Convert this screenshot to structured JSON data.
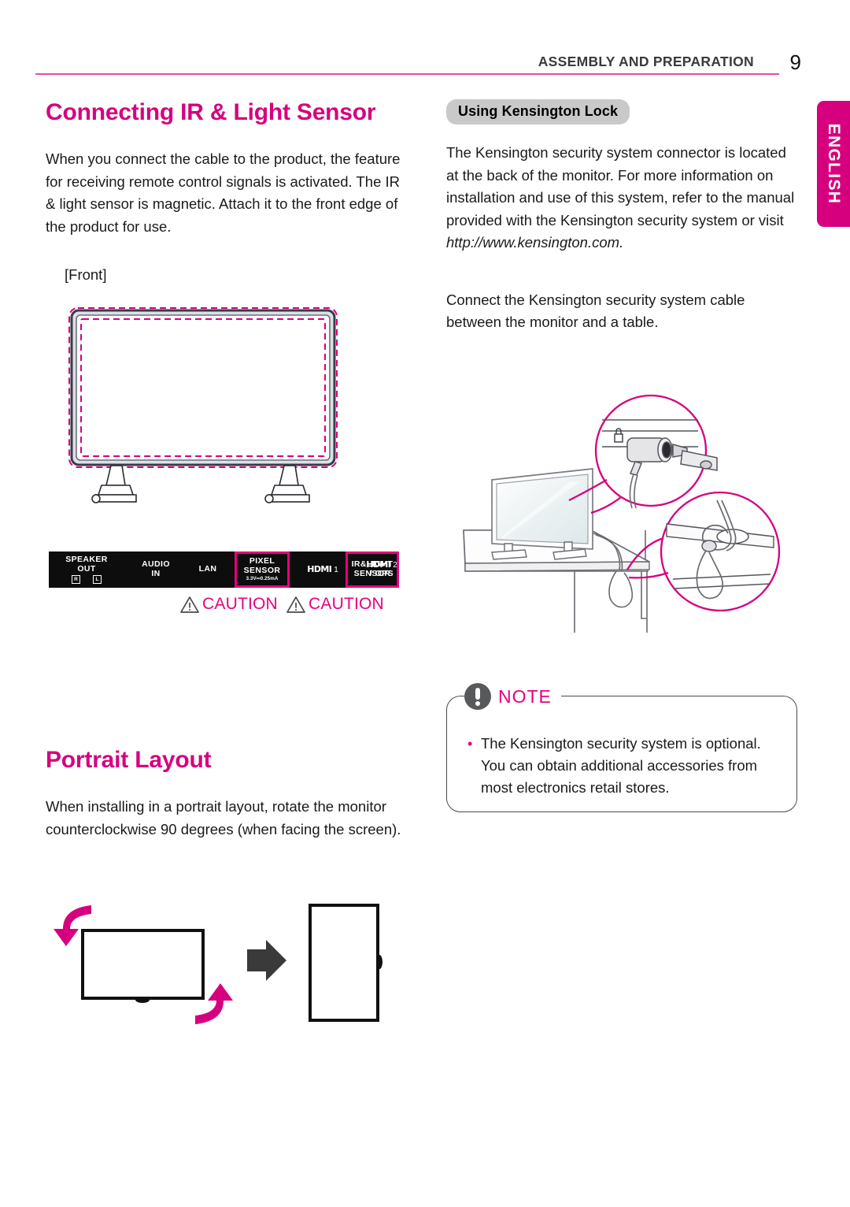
{
  "header": {
    "title": "ASSEMBLY AND PREPARATION",
    "page_number": "9",
    "rule_color": "#ee4b9b"
  },
  "language_tab": {
    "label": "ENGLISH",
    "color": "#d6007f"
  },
  "left_column": {
    "section_title": "Connecting IR & Light Sensor",
    "paragraph": "When you connect the cable to the product, the feature for receiving remote control signals is activated. The IR & light sensor is magnetic. Attach it to the front edge of the product for use.",
    "front_label": "[Front]",
    "port_strip": {
      "ports": [
        {
          "line1": "SPEAKER",
          "line2": "OUT",
          "sub": "",
          "channels": [
            "R",
            "L"
          ],
          "highlighted": false
        },
        {
          "line1": "AUDIO",
          "line2": "IN",
          "sub": "",
          "highlighted": false
        },
        {
          "line1": "LAN",
          "line2": "",
          "sub": "",
          "highlighted": false
        },
        {
          "line1": "PIXEL",
          "line2": "SENSOR",
          "sub": "3.3V⎓0.25mA",
          "highlighted": true
        },
        {
          "line1": "HDMI",
          "line2": "",
          "sub": "",
          "hdmi": true,
          "hdmi_number": "1",
          "highlighted": false
        },
        {
          "line1": "HDMI",
          "line2": "/ OPS",
          "sub": "",
          "hdmi": true,
          "hdmi_number": "2",
          "highlighted": false
        },
        {
          "line1": "IR&LIGHT",
          "line2": "SENSOR",
          "sub": "",
          "highlighted": true
        }
      ],
      "highlight_color": "#e6007e"
    },
    "cautions": [
      {
        "label": "CAUTION"
      },
      {
        "label": "CAUTION"
      }
    ]
  },
  "right_column": {
    "badge": "Using Kensington Lock",
    "paragraph_1_part1": "The Kensington security system connector is located at the back of the monitor. For more information on installation and use of this system, refer to the manual provided with the Kensington security system or visit ",
    "paragraph_1_link": "http://www.kensington.com",
    "paragraph_1_end": ".",
    "paragraph_2": "Connect the Kensington security system cable between the monitor and a table.",
    "note": {
      "title": "NOTE",
      "bullet_symbol": "•",
      "text": "The Kensington security system is optional. You can obtain additional accessories from most electronics retail stores."
    }
  },
  "portrait_section": {
    "section_title": "Portrait Layout",
    "paragraph": "When installing in a portrait layout, rotate the monitor counterclockwise 90 degrees (when facing the screen)."
  },
  "colors": {
    "accent_magenta": "#d6007f",
    "caution_magenta": "#e6007e",
    "rule_pink": "#ee4b9b",
    "badge_gray": "#c9c9c9",
    "note_gray": "#58595b"
  }
}
